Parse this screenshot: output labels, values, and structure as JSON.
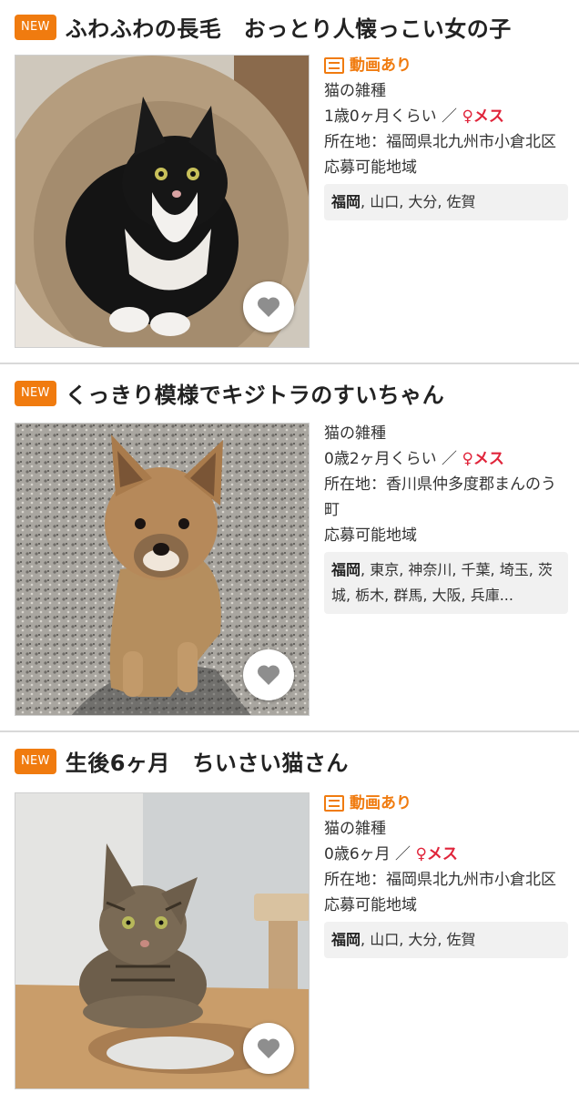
{
  "listings": [
    {
      "badge": "NEW",
      "title": "ふわふわの長毛　おっとり人懐っこい女の子",
      "video": "動画あり",
      "species": "猫の雑種",
      "age": "1歳0ヶ月くらい ／",
      "sex": "♀メス",
      "location": "所在地：福岡県北九州市小倉北区",
      "area_label": "応募可能地域",
      "area_primary": "福岡",
      "area_rest": ", 山口, 大分, 佐賀",
      "photo": "black-and-white-cat",
      "favorite_icon": "heart-icon"
    },
    {
      "badge": "NEW",
      "title": "くっきり模様でキジトラのすいちゃん",
      "video": "",
      "species": "猫の雑種",
      "age": "0歳2ヶ月くらい ／",
      "sex": "♀メス",
      "location": "所在地：香川県仲多度郡まんのう町",
      "area_label": "応募可能地域",
      "area_primary": "福岡",
      "area_rest": ", 東京, 神奈川, 千葉, 埼玉, 茨城, 栃木, 群馬, 大阪, 兵庫...",
      "photo": "puppy",
      "favorite_icon": "heart-icon"
    },
    {
      "badge": "NEW",
      "title": "生後6ヶ月　ちいさい猫さん",
      "video": "動画あり",
      "species": "猫の雑種",
      "age": "0歳6ヶ月 ／",
      "sex": "♀メス",
      "location": "所在地：福岡県北九州市小倉北区",
      "area_label": "応募可能地域",
      "area_primary": "福岡",
      "area_rest": ", 山口, 大分, 佐賀",
      "photo": "tabby-kitten",
      "favorite_icon": "heart-icon"
    }
  ],
  "colors": {
    "accent": "#f07b0f",
    "female": "#e0243a",
    "area_bg": "#f1f1f1"
  }
}
